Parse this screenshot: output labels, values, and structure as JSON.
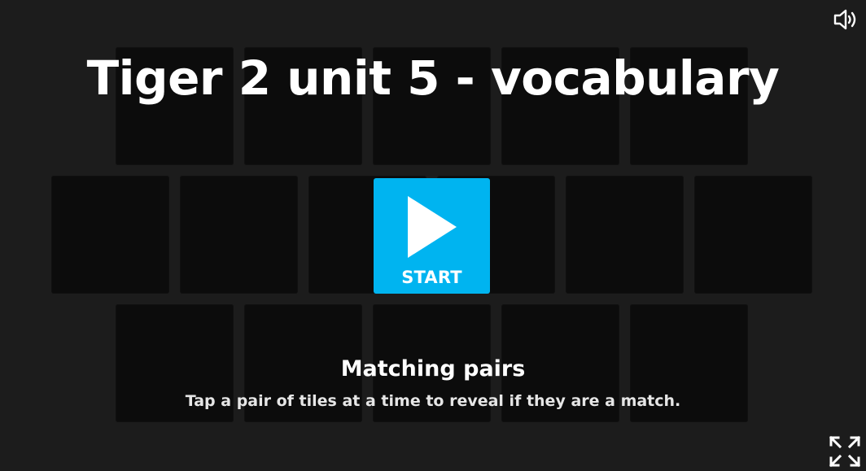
{
  "activity": {
    "title": "Tiger 2 unit 5 - vocabulary",
    "start_label": "START",
    "template_name": "Matching pairs",
    "instructions": "Tap a pair of tiles at a time to reveal if they are a match."
  },
  "controls": {
    "sound_icon": "speaker-icon",
    "fullscreen_icon": "fullscreen-icon",
    "play_icon": "play-icon"
  },
  "colors": {
    "background": "#1c1c1c",
    "tile": "#0c0c0c",
    "start_button": "#00b4f0",
    "text": "#ffffff"
  }
}
